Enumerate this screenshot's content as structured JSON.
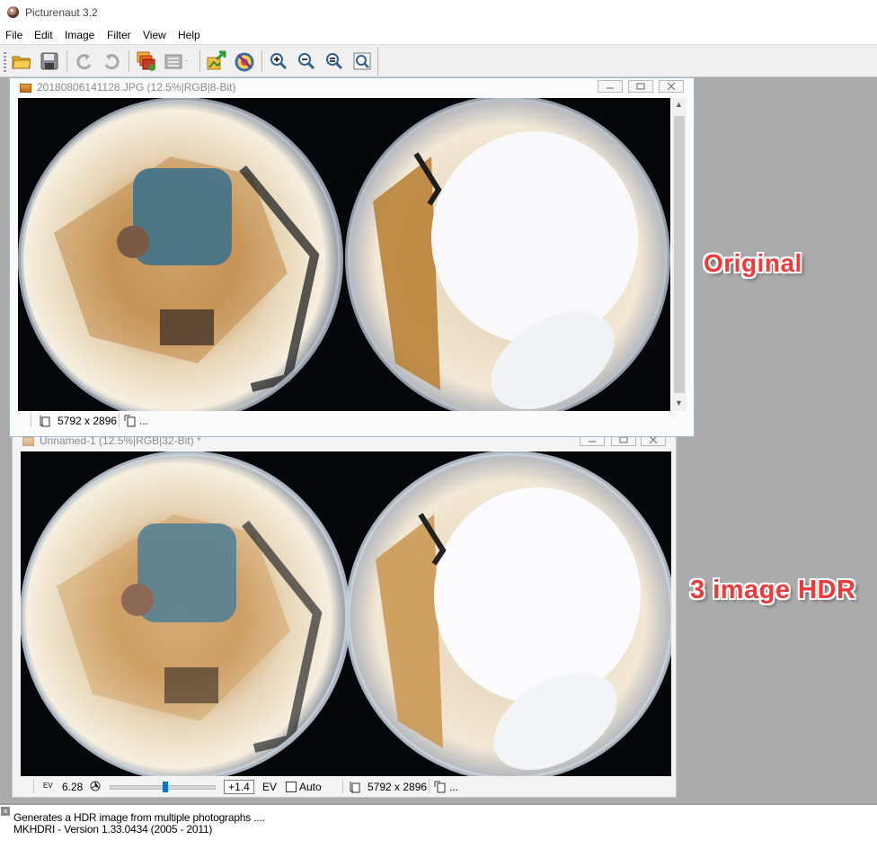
{
  "app": {
    "title": "Picturenaut 3.2"
  },
  "menu": [
    "File",
    "Edit",
    "Image",
    "Filter",
    "View",
    "Help"
  ],
  "toolbar": {
    "icons": [
      "open-folder-icon",
      "save-disk-icon",
      "undo-icon",
      "redo-icon",
      "hdr-stack-icon",
      "layers-dropdown-icon",
      "tonemap-icon",
      "color-wheel-icon",
      "zoom-in-icon",
      "zoom-out-icon",
      "zoom-fit-icon",
      "zoom-actual-icon"
    ]
  },
  "doc1": {
    "title": "20180806141128.JPG (12.5%|RGB|8-Bit)",
    "status": {
      "size": "5792 x 2896",
      "extra": "..."
    }
  },
  "doc2": {
    "title": "Unnamed-1 (12.5%|RGB|32-Bit) *",
    "status": {
      "ev_label": "EV",
      "ev_value": "6.28",
      "ev_input": "+1.4",
      "ev_unit": "EV",
      "auto_label": "Auto",
      "auto_checked": false,
      "size": "5792 x 2896",
      "extra": "..."
    }
  },
  "annotations": {
    "original": "Original",
    "hdr": "3 image HDR"
  },
  "log": [
    "Generates a HDR image from multiple photographs ....",
    "MKHDRI - Version 1.33.0434  (2005 - 2011)"
  ]
}
